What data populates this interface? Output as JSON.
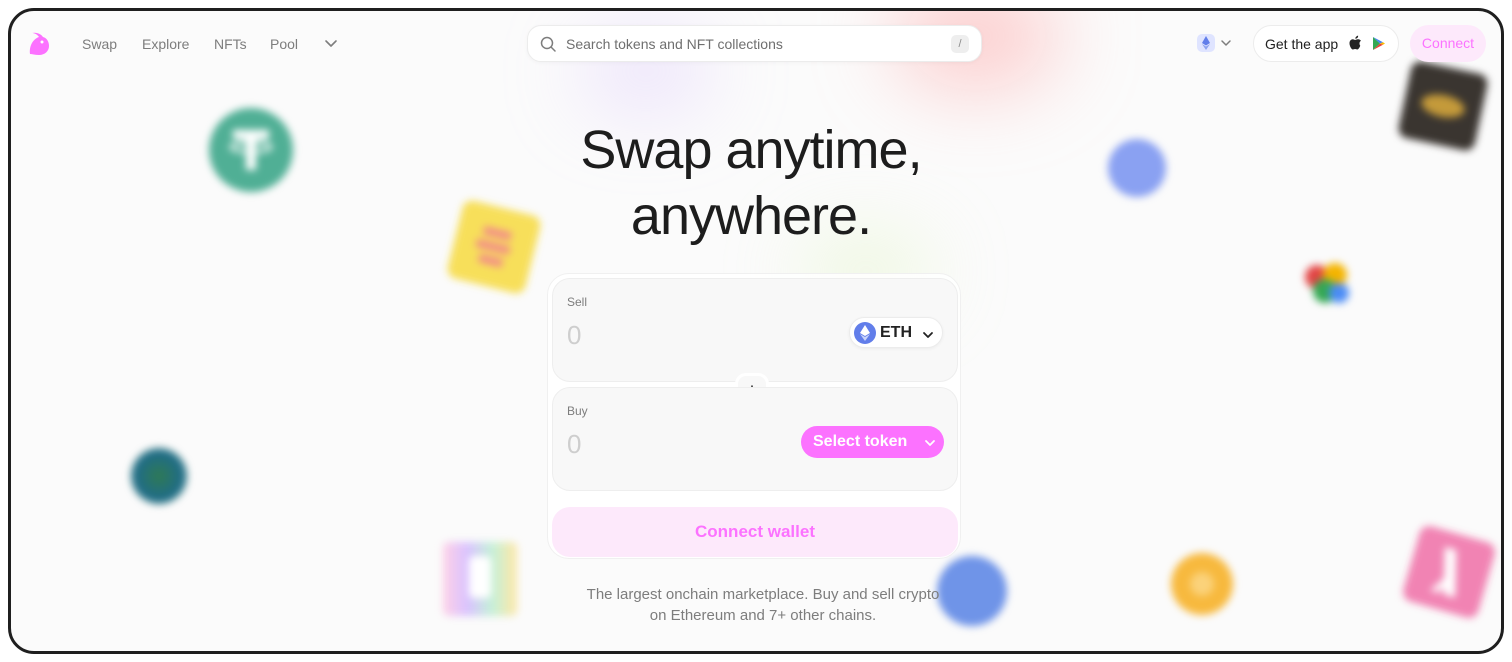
{
  "nav": {
    "items": [
      {
        "label": "Swap"
      },
      {
        "label": "Explore"
      },
      {
        "label": "NFTs"
      },
      {
        "label": "Pool"
      }
    ],
    "more_icon": "chevron-down-icon"
  },
  "search": {
    "placeholder": "Search tokens and NFT collections",
    "shortcut": "/"
  },
  "network": {
    "icon": "ethereum-icon"
  },
  "get_app": {
    "label": "Get the app"
  },
  "connect": {
    "label": "Connect"
  },
  "hero": {
    "line1": "Swap anytime,",
    "line2": "anywhere."
  },
  "swap": {
    "sell": {
      "label": "Sell",
      "amount_placeholder": "0",
      "token": "ETH"
    },
    "buy": {
      "label": "Buy",
      "amount_placeholder": "0",
      "token_button": "Select token"
    },
    "connect_wallet": "Connect wallet"
  },
  "tagline": {
    "line1": "The largest onchain marketplace. Buy and sell crypto",
    "line2": "on Ethereum and 7+ other chains."
  },
  "colors": {
    "accent": "#fc72ff",
    "accent_soft": "#fde9fb",
    "ethereum": "#627eea"
  }
}
